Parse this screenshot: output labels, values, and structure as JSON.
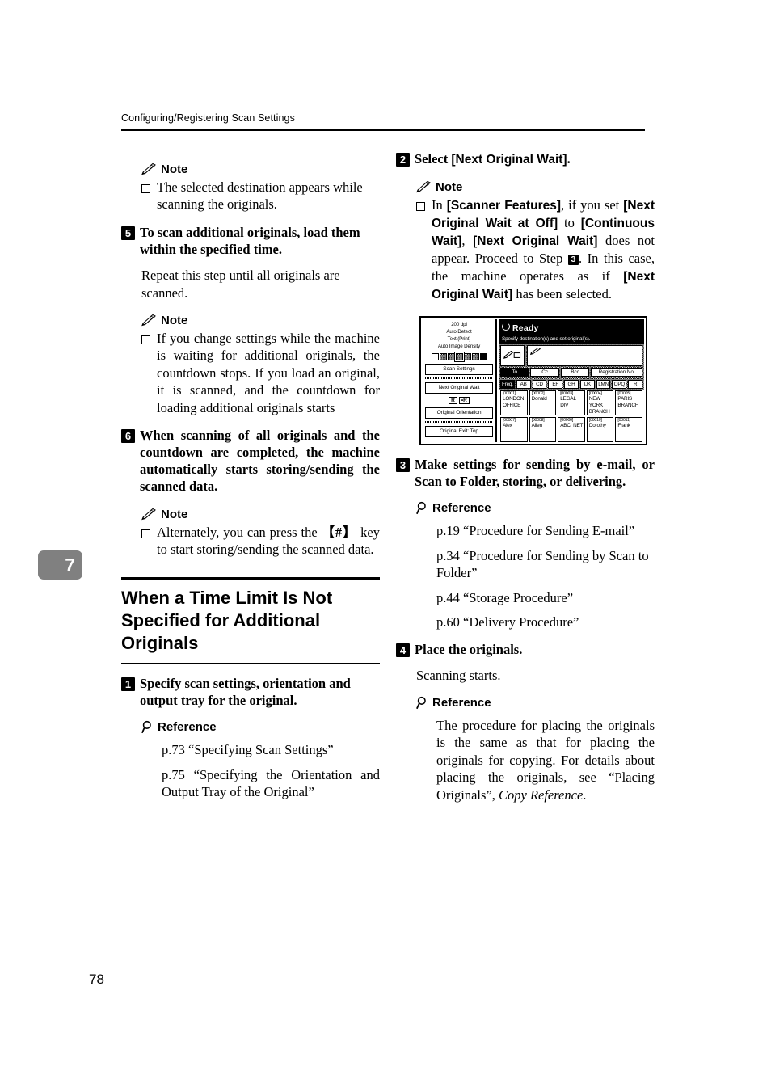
{
  "header": {
    "running_head": "Configuring/Registering Scan Settings"
  },
  "chapter_tab": "7",
  "page_number": "78",
  "left_column": {
    "note1": {
      "label": "Note",
      "items": [
        "The selected destination appears while scanning the originals."
      ]
    },
    "step5": {
      "num": "5",
      "text": "To scan additional originals, load them within the specified time.",
      "body": "Repeat this step until all originals are scanned."
    },
    "note2": {
      "label": "Note",
      "items": [
        "If you change settings while the machine is waiting for additional originals, the countdown stops. If you load an original, it is scanned, and the countdown for loading additional originals starts"
      ]
    },
    "step6": {
      "num": "6",
      "text": "When scanning of all originals and the countdown are completed, the machine automatically starts storing/sending the scanned data."
    },
    "note3": {
      "label": "Note",
      "item_prefix": "Alternately, you can press the ",
      "item_key": "【#】",
      "item_suffix": " key to start storing/sending the scanned data."
    },
    "section": {
      "title": "When a Time Limit Is Not Specified for Additional Originals"
    },
    "step1": {
      "num": "1",
      "text": "Specify scan settings, orientation and output tray for the original.",
      "reference_label": "Reference",
      "references": [
        "p.73 “Specifying Scan Settings”",
        "p.75 “Specifying the Orientation and Output Tray of the Original”"
      ]
    }
  },
  "right_column": {
    "step2": {
      "num": "2",
      "text_prefix": "Select ",
      "text_bold": "[Next Original Wait]",
      "text_suffix": "."
    },
    "note4": {
      "label": "Note",
      "seg": {
        "a": "In ",
        "b": "[Scanner Features]",
        "c": ", if you set ",
        "d": "[Next Original Wait at Off]",
        "e": " to ",
        "f": "[Continuous Wait]",
        "g": ", ",
        "h": "[Next Original Wait]",
        "i": " does not appear. Proceed to Step ",
        "j": "3",
        "k": ". In this case, the machine operates as if ",
        "l": "[Next Original Wait]",
        "m": " has been selected."
      }
    },
    "step3": {
      "num": "3",
      "text": "Make settings for sending by e-mail, or Scan to Folder, storing, or delivering.",
      "reference_label": "Reference",
      "references": [
        "p.19 “Procedure for Sending E-mail”",
        "p.34 “Procedure for Sending by Scan to Folder”",
        "p.44 “Storage Procedure”",
        "p.60 “Delivery Procedure”"
      ]
    },
    "step4": {
      "num": "4",
      "text": "Place the originals.",
      "body": "Scanning starts.",
      "reference_label": "Reference",
      "reference_text_a": "The procedure for placing the originals is the same as that for placing the originals for copying. For details about placing the originals, see “Placing Originals”, ",
      "reference_text_italic": "Copy Reference",
      "reference_text_b": "."
    }
  },
  "lcd": {
    "status_settings": [
      "200 dpi",
      "Auto Detect",
      "Text (Print)",
      "Auto Image Density"
    ],
    "buttons": {
      "scan_settings": "Scan Settings",
      "next_original_wait": "Next Original Wait",
      "orientation_a": "R",
      "orientation_b": "•R",
      "original_orientation": "Original Orientation",
      "original_exit": "Original Exit: Top"
    },
    "title": "Ready",
    "subtitle": "Specify destination(s) and set original(s).",
    "dest_tabs": [
      "To",
      "Cc",
      "Bcc",
      "Registration No."
    ],
    "dest_tab_selected": "To",
    "alpha_tabs": [
      "Freq.",
      "AB",
      "CD",
      "EF",
      "GH",
      "IJK",
      "LMN",
      "OPQ",
      "R"
    ],
    "alpha_tab_selected": "Freq.",
    "entries": [
      [
        {
          "id": "[00001]",
          "name": "LONDON OFFICE"
        },
        {
          "id": "[00002]",
          "name": "Donald"
        },
        {
          "id": "[00003]",
          "name": "LEGAL DIV"
        },
        {
          "id": "[00004]",
          "name": "NEW YORK BRANCH"
        },
        {
          "id": "[00005]",
          "name": "PARIS BRANCH"
        }
      ],
      [
        {
          "id": "[00007]",
          "name": "Alex"
        },
        {
          "id": "[00008]",
          "name": "Allen"
        },
        {
          "id": "[00009]",
          "name": "ABC_NET"
        },
        {
          "id": "[00010]",
          "name": "Dorothy"
        },
        {
          "id": "[00011]",
          "name": "Frank"
        }
      ]
    ]
  }
}
